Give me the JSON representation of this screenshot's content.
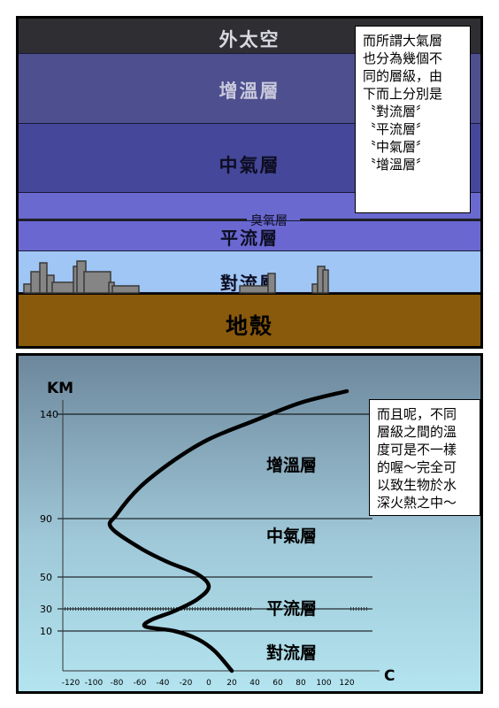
{
  "panel1": {
    "layers": {
      "outer_space": "外太空",
      "thermosphere": "增溫層",
      "mesosphere": "中氣層",
      "stratosphere": "平流層",
      "troposphere": "對流層",
      "crust": "地殼"
    },
    "ozone_label": "臭氧層",
    "caption_lines": [
      "而所謂大氣層",
      "也分為幾個不",
      "同的層級，由",
      "下而上分別是",
      "〝對流層〞",
      "〝平流層〞",
      "〝中氣層〞",
      "〝增溫層〞"
    ],
    "colors": {
      "outer_space": "#2f2f33",
      "thermosphere": "#4d4f8e",
      "mesosphere": "#45479a",
      "ozone_zone": "#6a69cf",
      "stratosphere": "#6a68d0",
      "troposphere": "#9fc6f5",
      "crust": "#8a5a0c"
    }
  },
  "panel2": {
    "axis_unit_y": "KM",
    "axis_unit_x": "C",
    "y_ticks": [
      "140",
      "90",
      "50",
      "30",
      "10"
    ],
    "x_ticks": [
      "-120",
      "-100",
      "-80",
      "-60",
      "-40",
      "-20",
      "0",
      "20",
      "40",
      "60",
      "80",
      "100",
      "120"
    ],
    "layer_labels": {
      "thermosphere": "增溫層",
      "mesosphere": "中氣層",
      "stratosphere": "平流層",
      "troposphere": "對流層"
    },
    "caption_lines": [
      "而且呢，不同",
      "層級之間的溫",
      "度可是不一樣",
      "的喔～完全可",
      "以致生物於水",
      "深火熱之中～"
    ],
    "chart_data": {
      "type": "line",
      "xlabel": "C",
      "ylabel": "KM",
      "xlim": [
        -120,
        120
      ],
      "ylim": [
        0,
        150
      ],
      "series": [
        {
          "x": [
            20,
            5,
            -10,
            -30,
            -55,
            -50,
            -30,
            -10,
            0,
            -10,
            -35,
            -60,
            -85,
            -80,
            -60,
            -30,
            0,
            40,
            80,
            120
          ],
          "y": [
            0,
            5,
            8,
            10,
            14,
            20,
            28,
            36,
            44,
            52,
            60,
            70,
            84,
            92,
            105,
            118,
            128,
            137,
            145,
            150
          ]
        }
      ]
    }
  }
}
